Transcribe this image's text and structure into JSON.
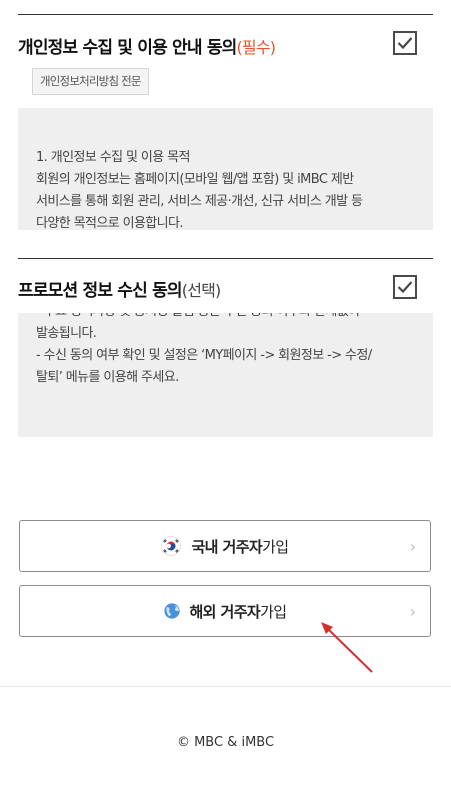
{
  "privacy_section": {
    "title": "개인정보 수집 및 이용 안내 동의",
    "tag": "(필수)",
    "checked": true,
    "policy_button_label": "개인정보처리방침 전문",
    "body_lines": [
      "1. 개인정보 수집 및 이용 목적",
      "회원의 개인정보는 홈페이지(모바일 웹/앱 포함) 및 iMBC 제반",
      "서비스를 통해 회원 관리, 서비스 제공·개선, 신규 서비스 개발 등",
      "다양한 목적으로 이용합니다."
    ]
  },
  "promo_section": {
    "title": "프로모션 정보 수신 동의",
    "tag": "(선택)",
    "checked": true,
    "body_lines": [
      "- 주요 정책사항 및 공지성 알림 등은 수신 동의 여부와 관계없이",
      "발송됩니다.",
      "- 수신 동의 여부 확인 및 설정은 ‘MY페이지 -> 회원정보 -> 수정/",
      "탈퇴’ 메뉴를 이용해 주세요."
    ]
  },
  "join_buttons": {
    "domestic": {
      "bold": "국내 거주자",
      "normal": "가입",
      "icon": "korea-flag-icon"
    },
    "overseas": {
      "bold": "해외 거주자",
      "normal": "가입",
      "icon": "globe-icon"
    }
  },
  "footer": {
    "copyright": "© MBC & iMBC"
  },
  "colors": {
    "required": "#e4572e",
    "annotation_arrow": "#d32f2f",
    "box_bg": "#efefef"
  }
}
